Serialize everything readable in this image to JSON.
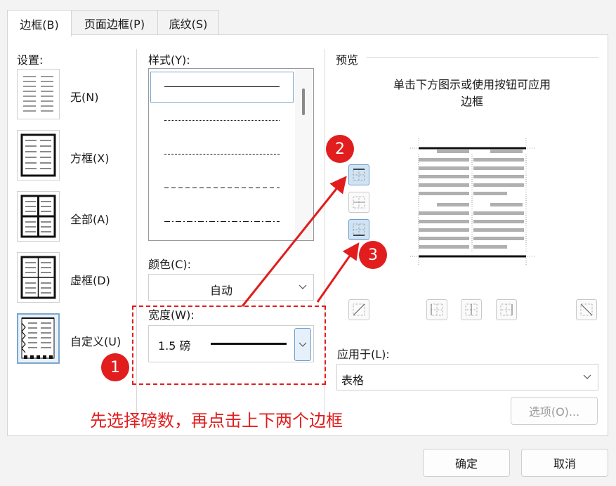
{
  "tabs": [
    {
      "label": "边框(B)",
      "active": true
    },
    {
      "label": "页面边框(P)",
      "active": false
    },
    {
      "label": "底纹(S)",
      "active": false
    }
  ],
  "setting": {
    "header": "设置:",
    "options": [
      {
        "label": "无(N)",
        "selected": false
      },
      {
        "label": "方框(X)",
        "selected": false
      },
      {
        "label": "全部(A)",
        "selected": false
      },
      {
        "label": "虚框(D)",
        "selected": false
      },
      {
        "label": "自定义(U)",
        "selected": true
      }
    ]
  },
  "style": {
    "label": "样式(Y):"
  },
  "color": {
    "label": "颜色(C):",
    "value": "自动"
  },
  "width": {
    "label": "宽度(W):",
    "value": "1.5 磅"
  },
  "preview": {
    "header": "预览",
    "hint_line1": "单击下方图示或使用按钮可应用",
    "hint_line2": "边框"
  },
  "apply_to": {
    "label": "应用于(L):",
    "value": "表格"
  },
  "buttons": {
    "options": "选项(O)...",
    "ok": "确定",
    "cancel": "取消"
  },
  "annotations": {
    "badge1": "1",
    "badge2": "2",
    "badge3": "3",
    "note": "先选择磅数，再点击上下两个边框",
    "color": "#e11d1d"
  },
  "colors": {
    "accent_blue": "#cfe3f4",
    "selected_border": "#7aa7cf"
  }
}
